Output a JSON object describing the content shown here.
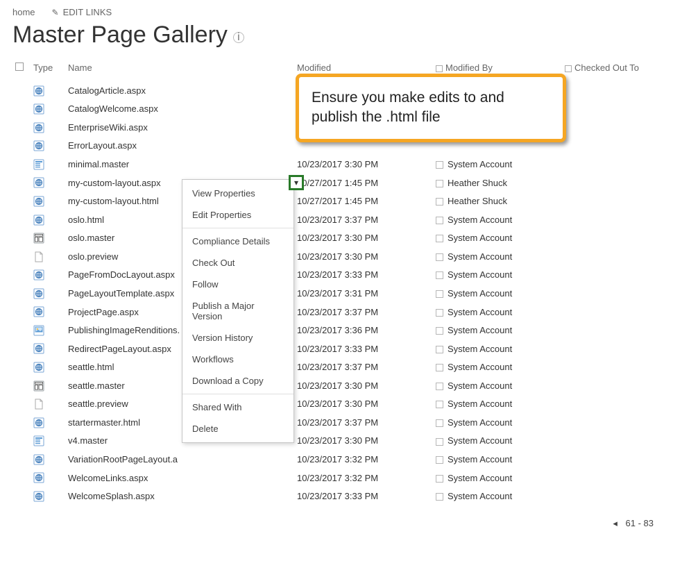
{
  "nav": {
    "home": "home",
    "edit_links": "EDIT LINKS"
  },
  "title": "Master Page Gallery",
  "columns": {
    "type": "Type",
    "name": "Name",
    "modified": "Modified",
    "modified_by": "Modified By",
    "checked_out": "Checked Out To"
  },
  "rows": [
    {
      "icon": "aspx",
      "name": "CatalogArticle.aspx",
      "modified": "",
      "by": ""
    },
    {
      "icon": "aspx",
      "name": "CatalogWelcome.aspx",
      "modified": "",
      "by": ""
    },
    {
      "icon": "aspx",
      "name": "EnterpriseWiki.aspx",
      "modified": "",
      "by": ""
    },
    {
      "icon": "aspx",
      "name": "ErrorLayout.aspx",
      "modified": "",
      "by": ""
    },
    {
      "icon": "master",
      "name": "minimal.master",
      "modified": "10/23/2017 3:30 PM",
      "by": "System Account"
    },
    {
      "icon": "aspx",
      "name": "my-custom-layout.aspx",
      "modified": "10/27/2017 1:45 PM",
      "by": "Heather Shuck"
    },
    {
      "icon": "aspx",
      "name": "my-custom-layout.html",
      "modified": "10/27/2017 1:45 PM",
      "by": "Heather Shuck"
    },
    {
      "icon": "aspx",
      "name": "oslo.html",
      "modified": "10/23/2017 3:37 PM",
      "by": "System Account"
    },
    {
      "icon": "layout",
      "name": "oslo.master",
      "modified": "10/23/2017 3:30 PM",
      "by": "System Account"
    },
    {
      "icon": "blank",
      "name": "oslo.preview",
      "modified": "10/23/2017 3:30 PM",
      "by": "System Account"
    },
    {
      "icon": "aspx",
      "name": "PageFromDocLayout.aspx",
      "modified": "10/23/2017 3:33 PM",
      "by": "System Account"
    },
    {
      "icon": "aspx",
      "name": "PageLayoutTemplate.aspx",
      "modified": "10/23/2017 3:31 PM",
      "by": "System Account"
    },
    {
      "icon": "aspx",
      "name": "ProjectPage.aspx",
      "modified": "10/23/2017 3:37 PM",
      "by": "System Account"
    },
    {
      "icon": "image",
      "name": "PublishingImageRenditions.",
      "modified": "10/23/2017 3:36 PM",
      "by": "System Account"
    },
    {
      "icon": "aspx",
      "name": "RedirectPageLayout.aspx",
      "modified": "10/23/2017 3:33 PM",
      "by": "System Account"
    },
    {
      "icon": "aspx",
      "name": "seattle.html",
      "modified": "10/23/2017 3:37 PM",
      "by": "System Account"
    },
    {
      "icon": "layout",
      "name": "seattle.master",
      "modified": "10/23/2017 3:30 PM",
      "by": "System Account"
    },
    {
      "icon": "blank",
      "name": "seattle.preview",
      "modified": "10/23/2017 3:30 PM",
      "by": "System Account"
    },
    {
      "icon": "aspx",
      "name": "startermaster.html",
      "modified": "10/23/2017 3:37 PM",
      "by": "System Account"
    },
    {
      "icon": "master",
      "name": "v4.master",
      "modified": "10/23/2017 3:30 PM",
      "by": "System Account"
    },
    {
      "icon": "aspx",
      "name": "VariationRootPageLayout.a",
      "modified": "10/23/2017 3:32 PM",
      "by": "System Account"
    },
    {
      "icon": "aspx",
      "name": "WelcomeLinks.aspx",
      "modified": "10/23/2017 3:32 PM",
      "by": "System Account"
    },
    {
      "icon": "aspx",
      "name": "WelcomeSplash.aspx",
      "modified": "10/23/2017 3:33 PM",
      "by": "System Account"
    }
  ],
  "context_menu": {
    "items": [
      "View Properties",
      "Edit Properties",
      "Compliance Details",
      "Check Out",
      "Follow",
      "Publish a Major Version",
      "Version History",
      "Workflows",
      "Download a Copy",
      "Shared With",
      "Delete"
    ],
    "sep_after": [
      1,
      8
    ]
  },
  "callout": {
    "text": "Ensure you make edits to and publish the .html file"
  },
  "pager": {
    "range": "61 - 83"
  }
}
